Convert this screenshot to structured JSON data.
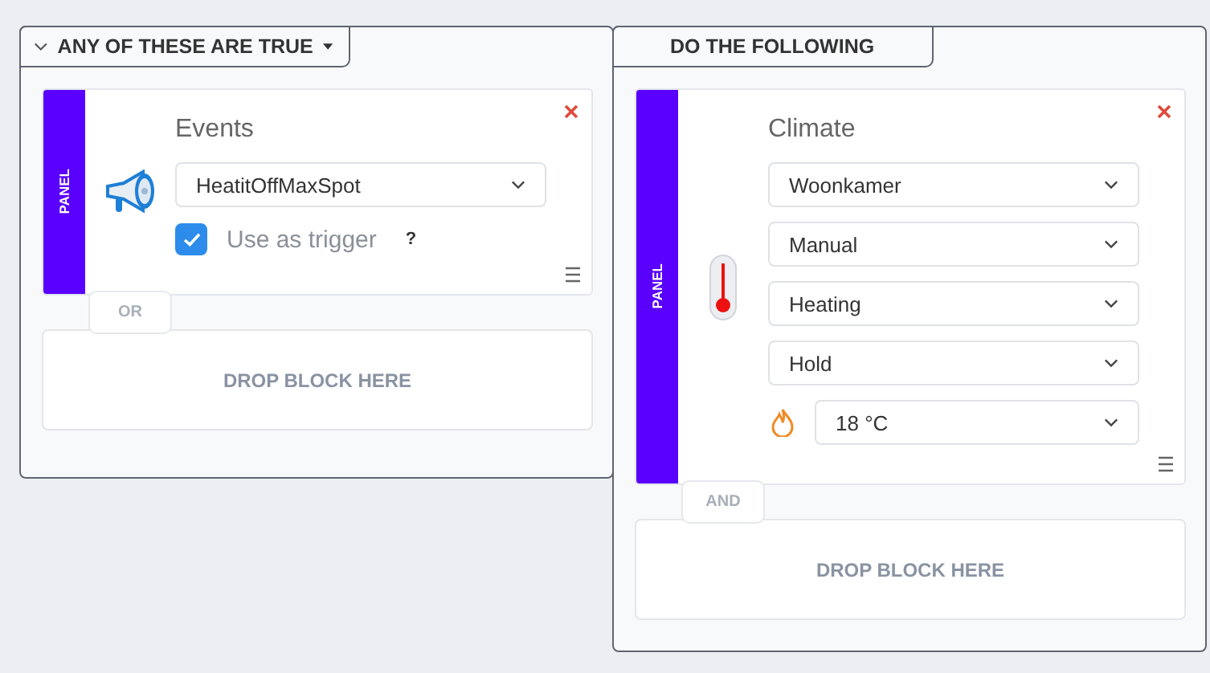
{
  "groups": [
    {
      "kind": "condition",
      "header": "ANY OF THESE ARE TRUE",
      "blocks": [
        {
          "kind": "events",
          "strip": "PANEL",
          "title": "Events",
          "dropdowns": [
            "HeatitOffMaxSpot"
          ],
          "trigger": {
            "label": "Use as trigger",
            "checked": true,
            "help": "?"
          }
        }
      ],
      "connector": "OR",
      "drop": "DROP BLOCK HERE"
    },
    {
      "kind": "action",
      "header": "DO THE FOLLOWING",
      "blocks": [
        {
          "kind": "climate",
          "strip": "PANEL",
          "title": "Climate",
          "dropdowns": [
            "Woonkamer",
            "Manual",
            "Heating",
            "Hold"
          ],
          "setpoint": "18 °C"
        }
      ],
      "connector": "AND",
      "drop": "DROP BLOCK HERE"
    }
  ]
}
